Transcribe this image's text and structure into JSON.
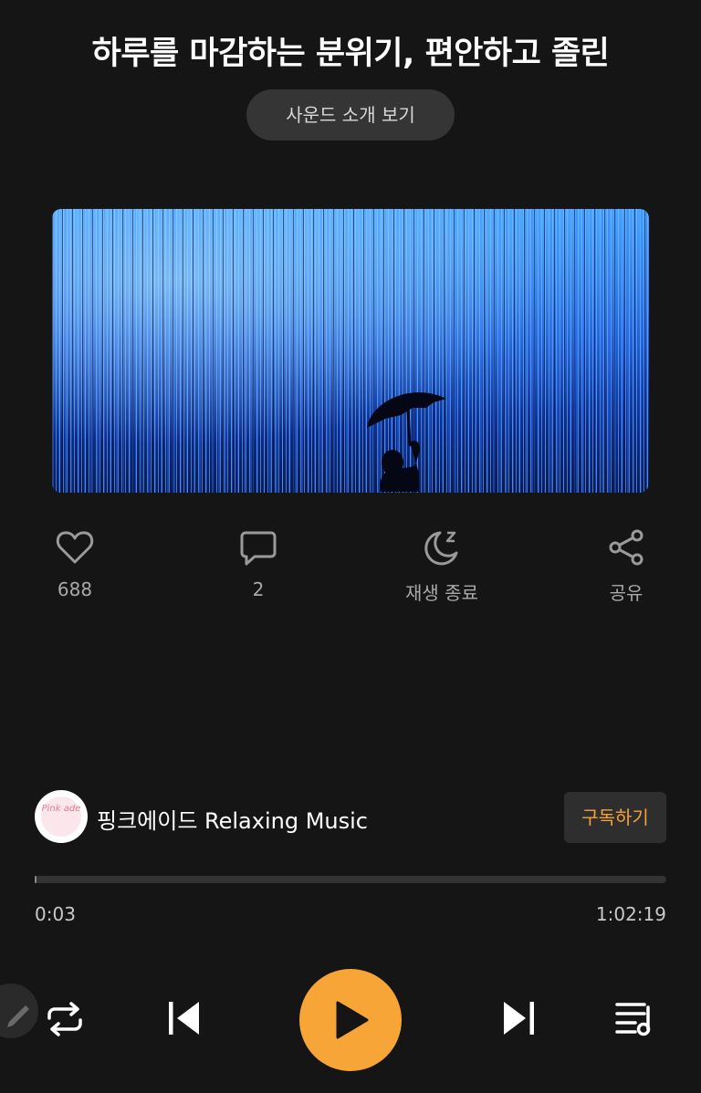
{
  "header": {
    "title": "하루를 마감하는 분위기, 편안하고 졸린",
    "intro_button": "사운드 소개 보기"
  },
  "actions": [
    {
      "icon": "heart-icon",
      "label": "688"
    },
    {
      "icon": "comment-icon",
      "label": "2"
    },
    {
      "icon": "sleep-timer-icon",
      "label": "재생 종료"
    },
    {
      "icon": "share-icon",
      "label": "공유"
    }
  ],
  "channel": {
    "name": "핑크에이드 Relaxing Music",
    "avatar_text": "Pink ade",
    "subscribe_label": "구독하기"
  },
  "progress": {
    "fraction": 0.0008,
    "current_time": "0:03",
    "total_time": "1:02:19"
  },
  "controls": [
    "repeat-icon",
    "previous-icon",
    "play-icon",
    "next-icon",
    "playlist-icon"
  ],
  "colors": {
    "background": "#151515",
    "accent": "#f7a536",
    "subscribe_text": "#f5a23a"
  }
}
